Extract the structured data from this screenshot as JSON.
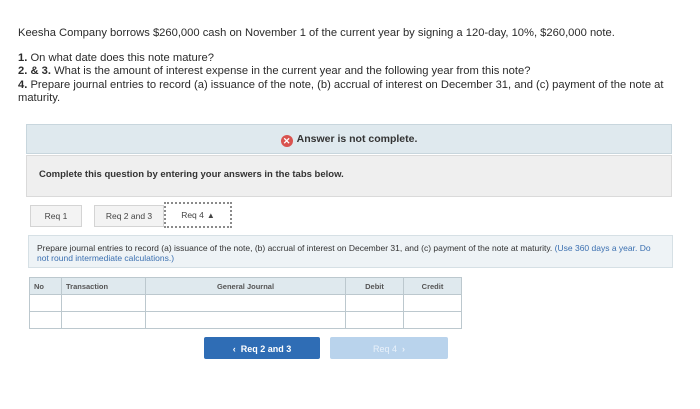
{
  "problem": {
    "intro": "Keesha Company borrows $260,000 cash on November 1 of the current year by signing a 120-day, 10%, $260,000 note.",
    "questions": [
      {
        "number": "1.",
        "text": "On what date does this note mature?"
      },
      {
        "number": "2. & 3.",
        "text": "What is the amount of interest expense in the current year and the following year from this note?"
      },
      {
        "number": "4.",
        "text": "Prepare journal entries to record (a) issuance of the note, (b) accrual of interest on December 31, and (c) payment of the note at maturity."
      }
    ]
  },
  "banner": {
    "text": "Answer is not complete.",
    "icon": "x-circle-icon",
    "color": "#d9534f"
  },
  "panel": {
    "message": "Complete this question by entering your answers in the tabs below."
  },
  "tabs": [
    {
      "label": "Req 1",
      "active": false
    },
    {
      "label": "Req 2 and 3",
      "active": false
    },
    {
      "label": "Req 4",
      "active": true
    }
  ],
  "instructions": {
    "text": "Prepare journal entries to record (a) issuance of the note, (b) accrual of interest on December 31, and (c) payment of the note at maturity.",
    "hint": "(Use 360 days a year. Do not round intermediate calculations.)"
  },
  "journal": {
    "columns": [
      "No",
      "Transaction",
      "General Journal",
      "Debit",
      "Credit"
    ],
    "rows": [
      [
        "",
        "",
        "",
        "",
        ""
      ],
      [
        "",
        "",
        "",
        "",
        ""
      ]
    ]
  },
  "nav": {
    "prev_label": "Req 2 and 3",
    "next_label": "Req 4",
    "primary_color": "#2f6db5"
  }
}
